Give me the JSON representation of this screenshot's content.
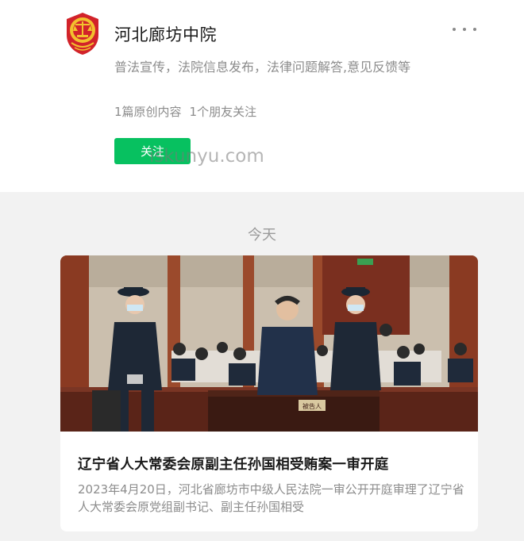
{
  "profile": {
    "name": "河北廊坊中院",
    "description": "普法宣传，法院信息发布，法律问题解答,意见反馈等",
    "stats": {
      "original": "1篇原创内容",
      "friends": "1个朋友关注"
    },
    "follow_label": "关注",
    "more_icon": "more-dots-icon",
    "avatar_icon": "court-emblem-icon"
  },
  "watermark": "iskunyu.com",
  "feed": {
    "date_label": "今天",
    "articles": [
      {
        "title": "辽宁省人大常委会原副主任孙国相受贿案一审开庭",
        "digest": "2023年4月20日，河北省廊坊市中级人民法院一审公开开庭审理了辽宁省人大常委会原党组副书记、副主任孙国相受",
        "cover_icon": "courtroom-photo",
        "nameplate": "被告人"
      }
    ]
  },
  "colors": {
    "accent": "#07c160",
    "background": "#f2f2f2",
    "emblem_red": "#d2232a",
    "emblem_gold": "#f2c12e"
  }
}
